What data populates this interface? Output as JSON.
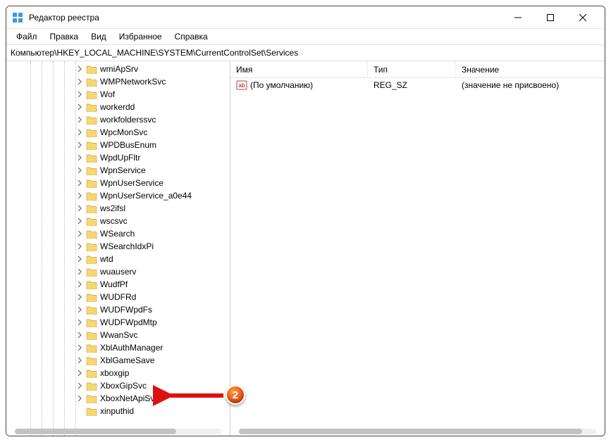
{
  "window": {
    "title": "Редактор реестра"
  },
  "menu": {
    "file": "Файл",
    "edit": "Правка",
    "view": "Вид",
    "favorites": "Избранное",
    "help": "Справка"
  },
  "address": {
    "label": "Компьютер\\HKEY_LOCAL_MACHINE\\SYSTEM\\CurrentControlSet\\Services"
  },
  "columns": {
    "name": "Имя",
    "type": "Тип",
    "value": "Значение"
  },
  "entries": [
    {
      "name": "(По умолчанию)",
      "type": "REG_SZ",
      "value": "(значение не присвоено)"
    }
  ],
  "tree": [
    {
      "label": "wmiApSrv",
      "expandable": true
    },
    {
      "label": "WMPNetworkSvc",
      "expandable": true
    },
    {
      "label": "Wof",
      "expandable": true
    },
    {
      "label": "workerdd",
      "expandable": true
    },
    {
      "label": "workfolderssvc",
      "expandable": true
    },
    {
      "label": "WpcMonSvc",
      "expandable": true
    },
    {
      "label": "WPDBusEnum",
      "expandable": true
    },
    {
      "label": "WpdUpFltr",
      "expandable": true
    },
    {
      "label": "WpnService",
      "expandable": true
    },
    {
      "label": "WpnUserService",
      "expandable": true
    },
    {
      "label": "WpnUserService_a0e44",
      "expandable": true
    },
    {
      "label": "ws2ifsl",
      "expandable": true
    },
    {
      "label": "wscsvc",
      "expandable": true
    },
    {
      "label": "WSearch",
      "expandable": true
    },
    {
      "label": "WSearchIdxPi",
      "expandable": true
    },
    {
      "label": "wtd",
      "expandable": true
    },
    {
      "label": "wuauserv",
      "expandable": true
    },
    {
      "label": "WudfPf",
      "expandable": true
    },
    {
      "label": "WUDFRd",
      "expandable": true
    },
    {
      "label": "WUDFWpdFs",
      "expandable": true
    },
    {
      "label": "WUDFWpdMtp",
      "expandable": true
    },
    {
      "label": "WwanSvc",
      "expandable": true
    },
    {
      "label": "XblAuthManager",
      "expandable": true
    },
    {
      "label": "XblGameSave",
      "expandable": true
    },
    {
      "label": "xboxgip",
      "expandable": true
    },
    {
      "label": "XboxGipSvc",
      "expandable": true
    },
    {
      "label": "XboxNetApiSvc",
      "expandable": true
    },
    {
      "label": "xinputhid",
      "expandable": false
    }
  ],
  "annotation": {
    "badge": "2"
  }
}
